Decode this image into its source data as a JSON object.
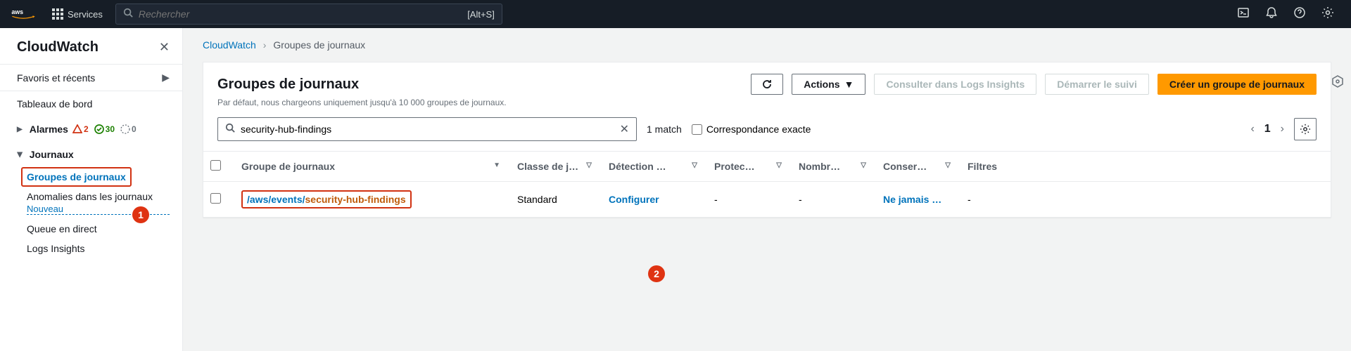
{
  "topnav": {
    "services": "Services",
    "search_placeholder": "Rechercher",
    "search_shortcut": "[Alt+S]"
  },
  "sidebar": {
    "title": "CloudWatch",
    "favorites": "Favoris et récents",
    "dashboards": "Tableaux de bord",
    "alarms": "Alarmes",
    "alarm_red": "2",
    "alarm_green": "30",
    "alarm_grey": "0",
    "logs": "Journaux",
    "log_groups": "Groupes de journaux",
    "anomalies": "Anomalies dans les journaux",
    "new": "Nouveau",
    "live_tail": "Queue en direct",
    "insights": "Logs Insights"
  },
  "breadcrumb": {
    "root": "CloudWatch",
    "current": "Groupes de journaux"
  },
  "panel": {
    "title": "Groupes de journaux",
    "subtitle": "Par défaut, nous chargeons uniquement jusqu'à 10 000 groupes de journaux.",
    "actions": "Actions",
    "insights": "Consulter dans Logs Insights",
    "start_tail": "Démarrer le suivi",
    "create": "Créer un groupe de journaux"
  },
  "filter": {
    "value": "security-hub-findings",
    "match": "1 match",
    "exact": "Correspondance exacte",
    "page": "1"
  },
  "table": {
    "headers": {
      "loggroup": "Groupe de journaux",
      "class": "Classe de j…",
      "detection": "Détection …",
      "protection": "Protec…",
      "count": "Nombr…",
      "retention": "Conser…",
      "filters": "Filtres"
    },
    "rows": [
      {
        "name_prefix": "/aws/events/",
        "name_match": "security-hub-findings",
        "class": "Standard",
        "detection": "Configurer",
        "protection": "-",
        "count": "-",
        "retention": "Ne jamais …",
        "filters": "-"
      }
    ]
  },
  "callouts": {
    "one": "1",
    "two": "2"
  }
}
